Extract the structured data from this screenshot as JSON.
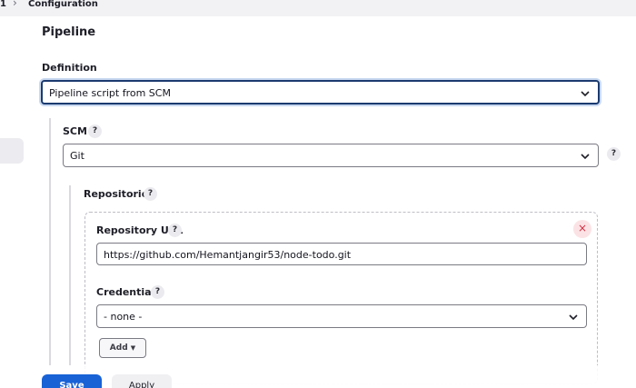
{
  "breadcrumb": {
    "item_number": "1",
    "separator_icon": "chevron-right-icon",
    "current": "Configuration"
  },
  "pipeline": {
    "title": "Pipeline",
    "definition_label": "Definition",
    "definition_value": "Pipeline script from SCM",
    "scm_label": "SCM",
    "scm_value": "Git",
    "help_glyph": "?"
  },
  "repositories": {
    "label": "Repositories",
    "repo_url_label": "Repository URL",
    "repo_url_value": "https://github.com/Hemantjangir53/node-todo.git",
    "credentials_label": "Credentials",
    "credentials_value": "- none -",
    "add_label": "Add",
    "add_icon": "caret-down-icon",
    "remove_glyph": "×"
  },
  "actions": {
    "save_label": "Save",
    "apply_label": "Apply"
  },
  "colors": {
    "primary": "#1862d6",
    "focus_border": "#1b3b6f",
    "remove_red": "#d33145"
  }
}
